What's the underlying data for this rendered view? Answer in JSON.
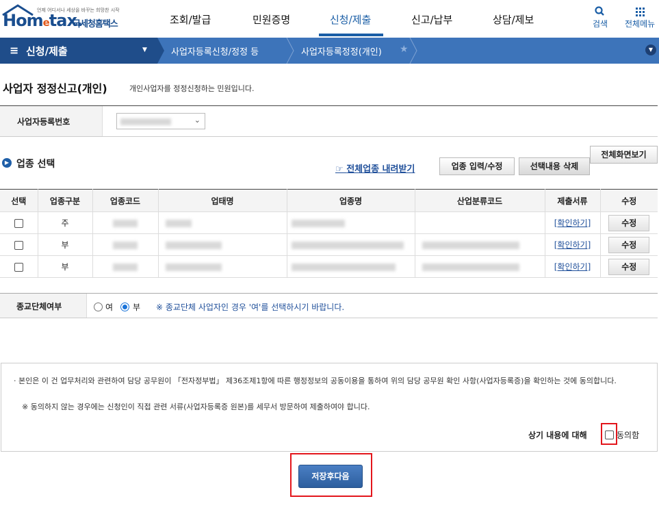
{
  "header": {
    "logo": {
      "tagline": "언제 어디서나 세상을 바꾸는 희망찬 시작",
      "brand_pre": "Hom",
      "brand_e": "e",
      "brand_post": "tax.",
      "agency": "국세청홈택스"
    },
    "nav": [
      "조회/발급",
      "민원증명",
      "신청/제출",
      "신고/납부",
      "상담/제보"
    ],
    "active_nav": "신청/제출",
    "search_label": "검색",
    "allmenu_label": "전체메뉴"
  },
  "crumbs": {
    "menu": "신청/제출",
    "level1": "사업자등록신청/정정 등",
    "level2": "사업자등록정정(개인)"
  },
  "page": {
    "title": "사업자 정정신고(개인)",
    "desc": "개인사업자를 정정신청하는 민원입니다."
  },
  "biz": {
    "label": "사업자등록번호"
  },
  "section": {
    "title": "업종 선택",
    "download_link": "전체업종 내려받기",
    "btn_edit": "업종 입력/수정",
    "btn_delete": "선택내용 삭제",
    "btn_fullscreen": "전체화면보기"
  },
  "table": {
    "headers": [
      "선택",
      "업종구분",
      "업종코드",
      "업태명",
      "업종명",
      "산업분류코드",
      "제출서류",
      "수정"
    ],
    "rows": [
      {
        "type": "주",
        "confirm": "[확인하기]",
        "edit": "수정"
      },
      {
        "type": "부",
        "confirm": "[확인하기]",
        "edit": "수정"
      },
      {
        "type": "부",
        "confirm": "[확인하기]",
        "edit": "수정"
      }
    ]
  },
  "religion": {
    "label": "종교단체여부",
    "yes": "여",
    "no": "부",
    "selected": "부",
    "note": "※ 종교단체 사업자인 경우 '여'를 선택하시기 바랍니다."
  },
  "consent": {
    "p1": "· 본인은 이 건 업무처리와 관련하여 담당 공무원이 「전자정부법」 제36조제1항에 따른 행정정보의 공동이용을 통하여 위의 담당 공무원 확인 사항(사업자등록증)을 확인하는 것에 동의합니다.",
    "p2": "※  동의하지 않는 경우에는 신청인이 직접 관련 서류(사업자등록증 원본)를 세무서 방문하여 제출하여야 합니다.",
    "agree_prefix": "상기 내용에 대해",
    "agree_label": "동의함"
  },
  "save_button": "저장후다음",
  "colors": {
    "brand": "#1a4e8f",
    "nav_active": "#1a5ea6",
    "bar": "#3d74ba",
    "bar_dark": "#1f4d8a",
    "highlight": "#e3151b"
  }
}
